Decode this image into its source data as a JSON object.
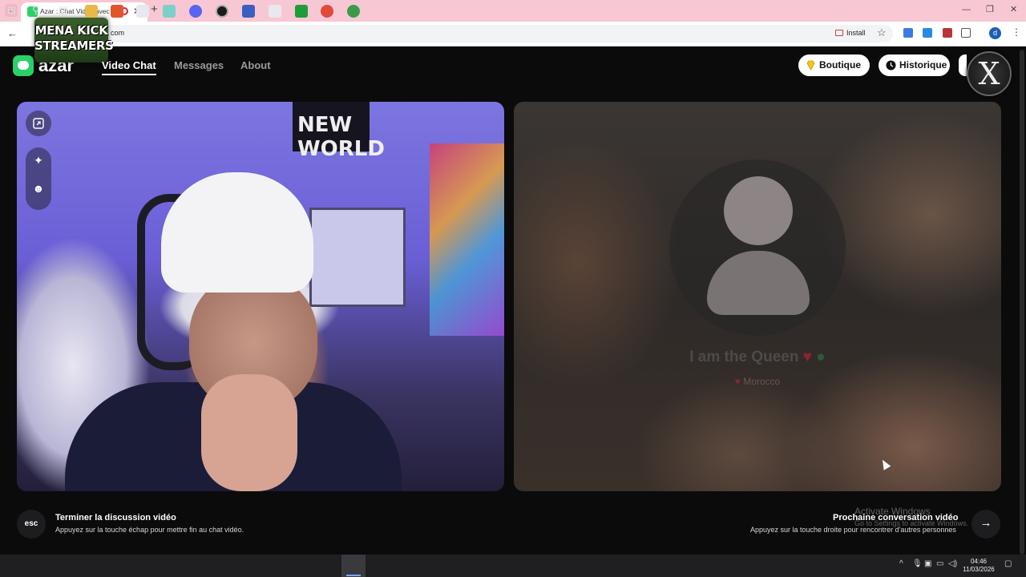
{
  "browser": {
    "tab_title": "Azar : Chat Vidéo avec de n",
    "url": "com",
    "install_label": "Install",
    "profile_initial": "d"
  },
  "overlay": {
    "logo_line1": "MENA KICK",
    "logo_line2": "STREAMERS",
    "badge_glyph": "X"
  },
  "app": {
    "name": "azar",
    "nav": [
      "Video Chat",
      "Messages",
      "About"
    ],
    "active_nav": "Video Chat",
    "boutique_label": "Boutique",
    "historique_label": "Historique",
    "accent_color": "#2bd168"
  },
  "left_video": {
    "poster_text": "NEW WORLD",
    "tools": [
      "expand-icon",
      "magic-wand-icon",
      "face-filter-icon"
    ]
  },
  "right_video": {
    "partner_name": "I am the Queen",
    "partner_country": "Morocco"
  },
  "footer": {
    "end_key": "esc",
    "end_title": "Terminer la discussion vidéo",
    "end_sub": "Appuyez sur la touche échap pour mettre fin au chat vidéo.",
    "next_title": "Prochaine conversation vidéo",
    "next_sub": "Appuyez sur la touche droite pour rencontrer d'autres personnes",
    "next_key": "→"
  },
  "windows": {
    "watermark_title": "Activate Windows",
    "watermark_sub": "Go to Settings to activate Windows.",
    "time": "04:46",
    "date": "11/03/2026"
  }
}
